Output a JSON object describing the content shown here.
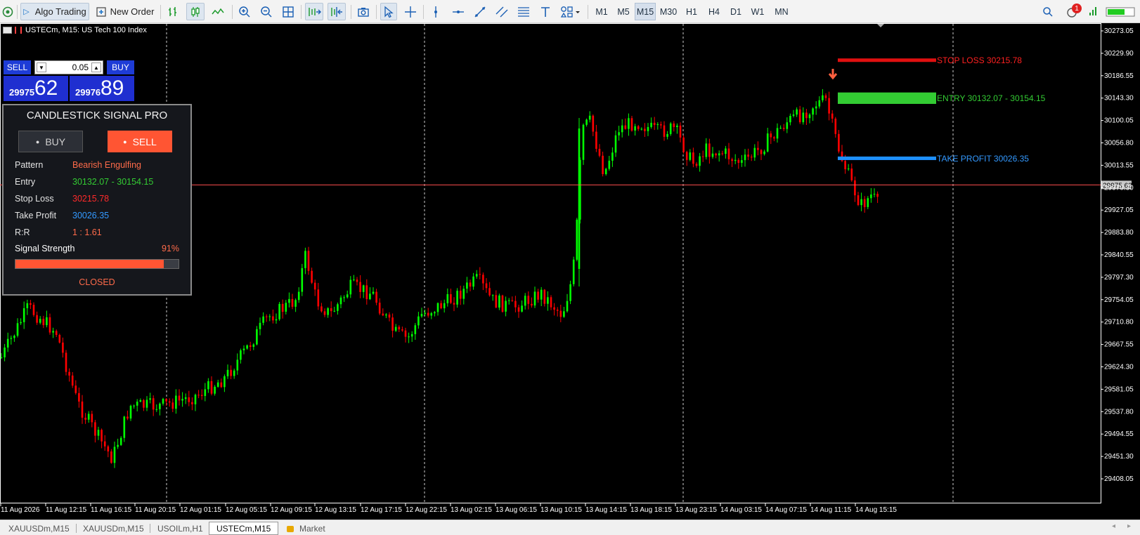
{
  "toolbar": {
    "algo_label": "Algo Trading",
    "neworder_label": "New Order",
    "timeframes": [
      "M1",
      "M5",
      "M15",
      "M30",
      "H1",
      "H4",
      "D1",
      "W1",
      "MN"
    ],
    "active_timeframe": "M15",
    "notification_count": "1"
  },
  "chart": {
    "title": "USTECm, M15:  US Tech 100 Index",
    "price_levels": [
      "30273.05",
      "30229.90",
      "30186.55",
      "30143.30",
      "30100.05",
      "30056.80",
      "30013.55",
      "29970.30",
      "29927.05",
      "29883.80",
      "29840.55",
      "29797.30",
      "29754.05",
      "29710.80",
      "29667.55",
      "29624.30",
      "29581.05",
      "29537.80",
      "29494.55",
      "29451.30",
      "29408.05"
    ],
    "current_price": "29975.62",
    "time_labels": [
      "11 Aug 2026",
      "11 Aug 12:15",
      "11 Aug 16:15",
      "11 Aug 20:15",
      "12 Aug 01:15",
      "12 Aug 05:15",
      "12 Aug 09:15",
      "12 Aug 13:15",
      "12 Aug 17:15",
      "12 Aug 22:15",
      "13 Aug 02:15",
      "13 Aug 06:15",
      "13 Aug 10:15",
      "13 Aug 14:15",
      "13 Aug 18:15",
      "13 Aug 23:15",
      "14 Aug 03:15",
      "14 Aug 07:15",
      "14 Aug 11:15",
      "14 Aug 15:15"
    ],
    "colors": {
      "bull": "#00ff00",
      "bear": "#ff0000",
      "sl": "#e01010",
      "entry": "#33cc33",
      "tp": "#1e90ff"
    }
  },
  "trade": {
    "sell_label": "SELL",
    "buy_label": "BUY",
    "lot": "0.05",
    "bid_small": "29975",
    "bid_big": "62",
    "ask_small": "29976",
    "ask_big": "89"
  },
  "levels": {
    "sl_label": "STOP LOSS  30215.78",
    "entry_label": "ENTRY  30132.07 - 30154.15",
    "tp_label": "TAKE PROFIT  30026.35"
  },
  "panel": {
    "title": "CANDLESTICK SIGNAL PRO",
    "buy_label": "BUY",
    "sell_label": "SELL",
    "rows": [
      {
        "key": "Pattern",
        "value": "Bearish Engulfing",
        "color": "#ff6b4a"
      },
      {
        "key": "Entry",
        "value": "30132.07 - 30154.15",
        "color": "#33cc33"
      },
      {
        "key": "Stop Loss",
        "value": "30215.78",
        "color": "#ff2a2a"
      },
      {
        "key": "Take Profit",
        "value": "30026.35",
        "color": "#3399ff"
      },
      {
        "key": "R:R",
        "value": "1 : 1.61",
        "color": "#ff6b4a"
      }
    ],
    "strength_label": "Signal Strength",
    "strength_value": "91%",
    "strength_fraction": 0.91,
    "status": "CLOSED"
  },
  "tabs": [
    "XAUUSDm,M15",
    "XAUUSDm,M15",
    "USOILm,H1",
    "USTECm,M15",
    "Market"
  ],
  "active_tab": "USTECm,M15"
}
